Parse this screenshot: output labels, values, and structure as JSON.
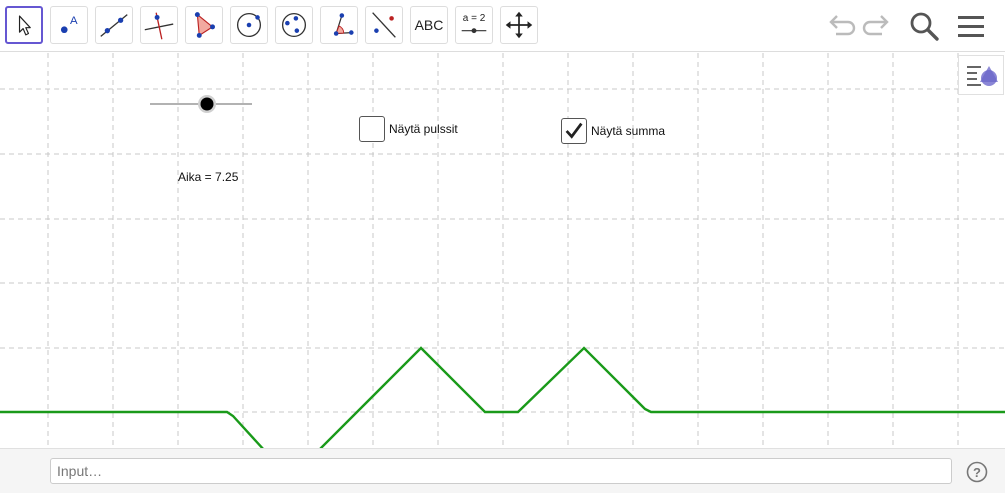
{
  "toolbar": {
    "tools": [
      {
        "name": "move-tool",
        "selected": true
      },
      {
        "name": "point-tool"
      },
      {
        "name": "line-tool"
      },
      {
        "name": "perpendicular-line-tool"
      },
      {
        "name": "polygon-tool"
      },
      {
        "name": "circle-center-point-tool"
      },
      {
        "name": "conic-tool"
      },
      {
        "name": "angle-tool"
      },
      {
        "name": "reflect-tool"
      },
      {
        "name": "text-tool",
        "label": "ABC"
      },
      {
        "name": "slider-tool",
        "label": "a = 2"
      },
      {
        "name": "move-graphics-view-tool"
      }
    ],
    "right": [
      "undo-icon",
      "redo-icon",
      "search-icon",
      "menu-icon"
    ]
  },
  "graphics": {
    "slider_label": "Aika = 7.25",
    "slider_value": 7.25,
    "checkboxes": [
      {
        "label": "Näytä pulssit",
        "checked": false
      },
      {
        "label": "Näytä summa",
        "checked": true
      }
    ],
    "curve_color": "#1a9a1a",
    "grid_color": "#c8c8c8"
  },
  "input_bar": {
    "placeholder": "Input…",
    "help_icon": "help-icon"
  }
}
